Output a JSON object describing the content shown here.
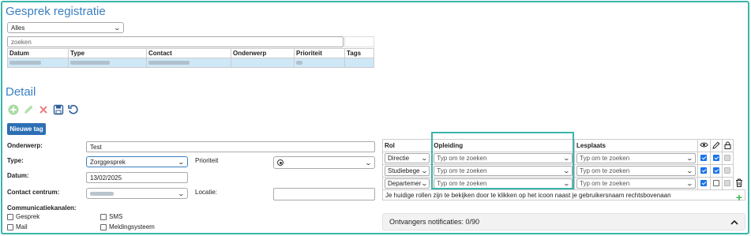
{
  "registration": {
    "title": "Gesprek registratie",
    "filter_value": "Alles",
    "search_placeholder": "zoeken",
    "columns": [
      "Datum",
      "Type",
      "Contact",
      "Onderwerp",
      "Prioriteit",
      "Tags"
    ]
  },
  "detail": {
    "title": "Detail",
    "new_tag_label": "Nieuwe tag",
    "toolbar_icons": [
      "add-icon",
      "edit-icon",
      "delete-icon",
      "save-icon",
      "undo-icon"
    ],
    "onderwerp_label": "Onderwerp:",
    "onderwerp_value": "Test",
    "type_label": "Type:",
    "type_value": "Zorggesprek",
    "prioriteit_label": "Prioriteit",
    "datum_label": "Datum:",
    "datum_value": "13/02/2025",
    "contact_centrum_label": "Contact centrum:",
    "locatie_label": "Locatie:",
    "communicatie_label": "Communicatiekanalen:",
    "channels": {
      "gesprek": "Gesprek",
      "sms": "SMS",
      "mail": "Mail",
      "meldingsysteem": "Meldingsysteem"
    }
  },
  "roles": {
    "headers": {
      "rol": "Rol",
      "opleiding": "Opleiding",
      "lesplaats": "Lesplaats"
    },
    "rows": [
      {
        "rol": "Directie",
        "opleiding": "Typ om te zoeken",
        "lesplaats": "Typ om te zoeken"
      },
      {
        "rol": "Studiebege",
        "opleiding": "Typ om te zoeken",
        "lesplaats": "Typ om te zoeken"
      },
      {
        "rol": "Departemer",
        "opleiding": "Typ om te zoeken",
        "lesplaats": "Typ om te zoeken"
      }
    ],
    "hint": "Je huidige rollen zijn te bekijken door te klikken op het icoon naast je gebruikersnaam rechtsbovenaan",
    "notifications_label": "Ontvangers notificaties: 0/90"
  },
  "colors": {
    "accent": "#3bb5ab",
    "title_blue": "#3a7fc1",
    "button_blue": "#2d6fb4",
    "selected_row": "#cfe8f7",
    "add_green": "#3db85a",
    "delete_red": "#e24b4b"
  }
}
